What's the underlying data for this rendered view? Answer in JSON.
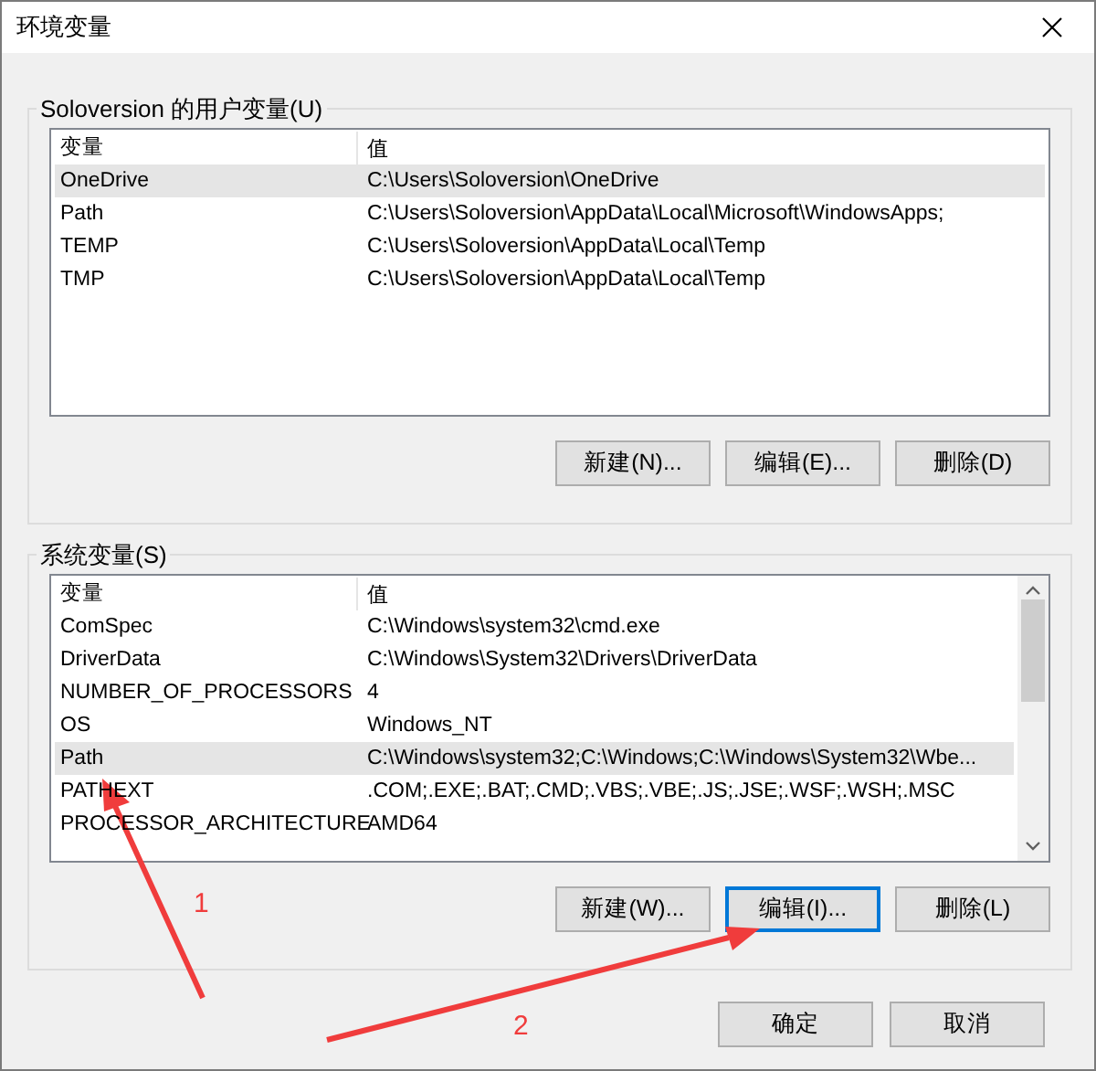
{
  "window": {
    "title": "环境变量"
  },
  "user_vars": {
    "label": "Soloversion 的用户变量(U)",
    "columns": [
      "变量",
      "值"
    ],
    "rows": [
      {
        "name": "OneDrive",
        "value": "C:\\Users\\Soloversion\\OneDrive",
        "selected": true
      },
      {
        "name": "Path",
        "value": "C:\\Users\\Soloversion\\AppData\\Local\\Microsoft\\WindowsApps;",
        "selected": false
      },
      {
        "name": "TEMP",
        "value": "C:\\Users\\Soloversion\\AppData\\Local\\Temp",
        "selected": false
      },
      {
        "name": "TMP",
        "value": "C:\\Users\\Soloversion\\AppData\\Local\\Temp",
        "selected": false
      }
    ],
    "buttons": [
      {
        "label": "新建(N)...",
        "focused": false
      },
      {
        "label": "编辑(E)...",
        "focused": false
      },
      {
        "label": "删除(D)",
        "focused": false
      }
    ]
  },
  "system_vars": {
    "label": "系统变量(S)",
    "columns": [
      "变量",
      "值"
    ],
    "rows": [
      {
        "name": "ComSpec",
        "value": "C:\\Windows\\system32\\cmd.exe",
        "selected": false
      },
      {
        "name": "DriverData",
        "value": "C:\\Windows\\System32\\Drivers\\DriverData",
        "selected": false
      },
      {
        "name": "NUMBER_OF_PROCESSORS",
        "value": "4",
        "selected": false
      },
      {
        "name": "OS",
        "value": "Windows_NT",
        "selected": false
      },
      {
        "name": "Path",
        "value": "C:\\Windows\\system32;C:\\Windows;C:\\Windows\\System32\\Wbe...",
        "selected": true
      },
      {
        "name": "PATHEXT",
        "value": ".COM;.EXE;.BAT;.CMD;.VBS;.VBE;.JS;.JSE;.WSF;.WSH;.MSC",
        "selected": false
      },
      {
        "name": "PROCESSOR_ARCHITECTURE",
        "value": "AMD64",
        "selected": false
      }
    ],
    "buttons": [
      {
        "label": "新建(W)...",
        "focused": false
      },
      {
        "label": "编辑(I)...",
        "focused": true
      },
      {
        "label": "删除(L)",
        "focused": false
      }
    ]
  },
  "buttons": [
    {
      "label": "确定",
      "focused": false
    },
    {
      "label": "取消",
      "focused": false
    }
  ],
  "annotations": [
    {
      "label": "1"
    },
    {
      "label": "2"
    }
  ]
}
